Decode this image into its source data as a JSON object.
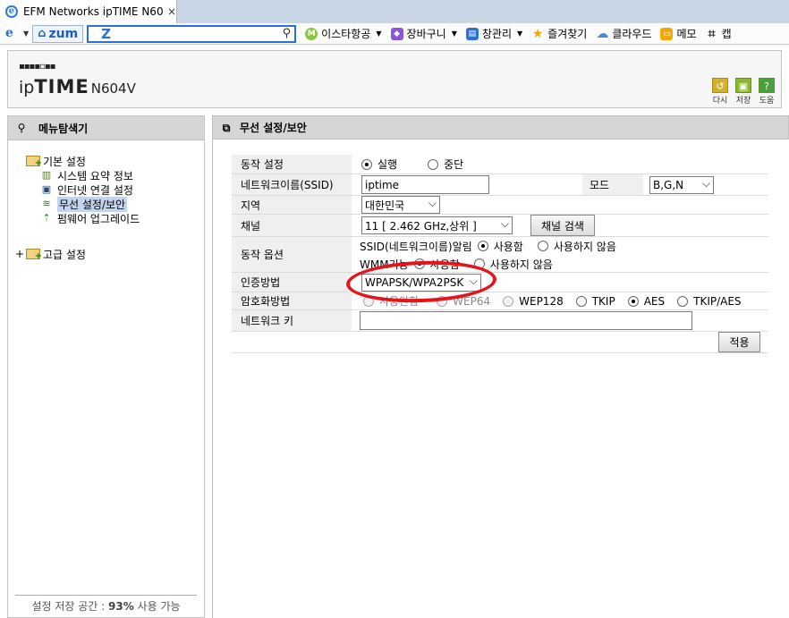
{
  "browser": {
    "tab_title": "EFM Networks ipTIME N60...",
    "tab_close": "×",
    "tab_ghost": "",
    "zum_label": "zum",
    "search_logo": "Z",
    "search_value": "",
    "bookmarks": [
      {
        "label": "이스타항공",
        "icon_color": "#8cc63f",
        "icon_char": "M"
      },
      {
        "label": "장바구니",
        "icon_color": "#8a55d6",
        "icon_char": "◆"
      },
      {
        "label": "창관리",
        "icon_color": "#2a6fdc",
        "icon_char": "▤"
      },
      {
        "label": "즐겨찾기",
        "icon_color": "#f2a900",
        "icon_char": "★"
      },
      {
        "label": "클라우드",
        "icon_color": "#3a8de0",
        "icon_char": "☁"
      },
      {
        "label": "메모",
        "icon_color": "#f2a900",
        "icon_char": "▭"
      },
      {
        "label": "캡",
        "icon_color": "#333333",
        "icon_char": "⌗"
      }
    ]
  },
  "header": {
    "logo_ip": "ip",
    "logo_time": "TIME",
    "logo_model": "N604V",
    "buttons": [
      {
        "label": "다시",
        "color": "#d4b030",
        "icon": "↺"
      },
      {
        "label": "저장",
        "color": "#8ab830",
        "icon": "▣"
      },
      {
        "label": "도움",
        "color": "#4aa038",
        "icon": "?"
      }
    ]
  },
  "left": {
    "title": "메뉴탐색기",
    "basic_settings": "기본 설정",
    "items": [
      {
        "label": "시스템 요약 정보"
      },
      {
        "label": "인터넷 연결 설정"
      },
      {
        "label": "무선 설정/보안"
      },
      {
        "label": "펌웨어 업그레이드"
      }
    ],
    "expander": "+",
    "advanced_settings": "고급 설정",
    "storage_prefix": "설정 저장 공간 : ",
    "storage_value": "93%",
    "storage_suffix": " 사용 가능"
  },
  "main": {
    "title": "무선 설정/보안",
    "operation": {
      "label": "동작 설정",
      "opt_run": "실행",
      "opt_stop": "중단"
    },
    "ssid": {
      "label": "네트워크이름(SSID)",
      "value": "iptime"
    },
    "mode": {
      "label": "모드",
      "value": "B,G,N"
    },
    "region": {
      "label": "지역",
      "value": "대한민국"
    },
    "channel": {
      "label": "채널",
      "value": "11 [ 2.462 GHz,상위 ]",
      "search_button": "채널 검색"
    },
    "options": {
      "label": "동작 옵션",
      "ssid_broadcast": "SSID(네트워크이름)알림",
      "wmm": "WMM기능",
      "use": "사용함",
      "not_use": "사용하지 않음"
    },
    "auth": {
      "label": "인증방법",
      "value": "WPAPSK/WPA2PSK"
    },
    "encryption": {
      "label": "암호화방법",
      "opts": [
        "사용안함",
        "WEP64",
        "WEP128",
        "TKIP",
        "AES",
        "TKIP/AES"
      ]
    },
    "netkey": {
      "label": "네트워크 키",
      "value": ""
    },
    "apply_button": "적용"
  },
  "colors": {
    "highlight": "#e8121b",
    "selected": "#c4d4ec"
  }
}
